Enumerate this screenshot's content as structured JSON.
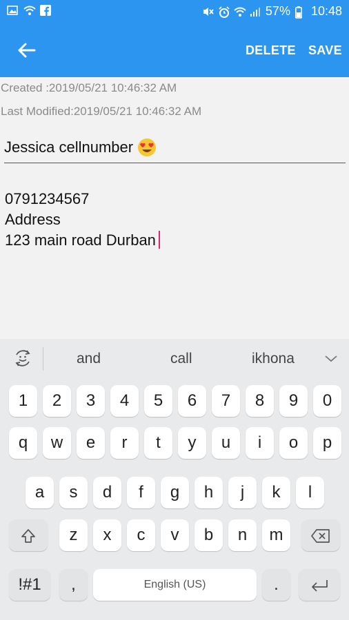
{
  "status_bar": {
    "battery": "57%",
    "time": "10:48",
    "left_icons": [
      "image-icon",
      "wifi-icon",
      "facebook-icon"
    ],
    "right_icons": [
      "mute-icon",
      "alarm-icon",
      "wifi-signal-icon",
      "cell-signal-icon",
      "battery-icon"
    ]
  },
  "app_bar": {
    "delete_label": "DELETE",
    "save_label": "SAVE",
    "color": "#2b95ef"
  },
  "note": {
    "created": "Created :2019/05/21 10:46:32 AM",
    "modified": "Last Modified:2019/05/21 10:46:32 AM",
    "title": "Jessica cellnumber",
    "body_lines": [
      "0791234567",
      "Address",
      "123 main road Durban"
    ]
  },
  "keyboard": {
    "suggestions": [
      "and",
      "call",
      "ikhona"
    ],
    "number_row": [
      "1",
      "2",
      "3",
      "4",
      "5",
      "6",
      "7",
      "8",
      "9",
      "0"
    ],
    "row1": [
      "q",
      "w",
      "e",
      "r",
      "t",
      "y",
      "u",
      "i",
      "o",
      "p"
    ],
    "row2": [
      "a",
      "s",
      "d",
      "f",
      "g",
      "h",
      "j",
      "k",
      "l"
    ],
    "row3": [
      "z",
      "x",
      "c",
      "v",
      "b",
      "n",
      "m"
    ],
    "symbols_label": "!#1",
    "comma_label": ",",
    "space_label": "English (US)",
    "period_label": "."
  }
}
